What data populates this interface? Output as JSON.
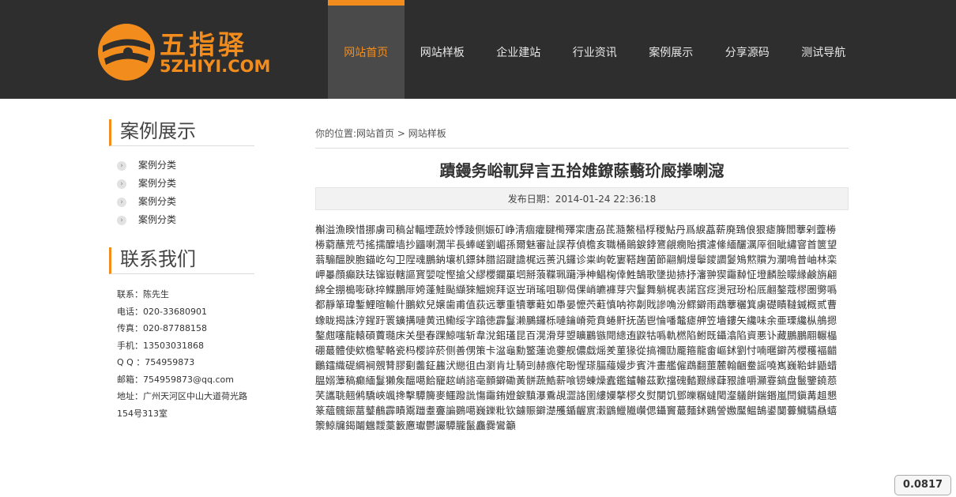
{
  "brand": {
    "name_cn": "五指驿",
    "name_en": "5ZHIYI.COM",
    "accent": "#f28c1c",
    "header_bg": "#2e2e2e"
  },
  "nav": [
    {
      "label": "网站首页",
      "active": true
    },
    {
      "label": "网站样板",
      "active": false
    },
    {
      "label": "企业建站",
      "active": false
    },
    {
      "label": "行业资讯",
      "active": false
    },
    {
      "label": "案例展示",
      "active": false
    },
    {
      "label": "分享源码",
      "active": false
    },
    {
      "label": "测试导航",
      "active": false
    }
  ],
  "sidebar": {
    "cases_title": "案例展示",
    "categories": [
      "案例分类",
      "案例分类",
      "案例分类",
      "案例分类"
    ],
    "contact_title": "联系我们",
    "contact": [
      "联系：陈先生",
      "电话：020-33680901",
      "传真：020-87788158",
      "手机：13503031868",
      "Q Q ：754959873",
      "邮箱：754959873@qq.com",
      "地址：广州天河区中山大道荷光路154号313室"
    ]
  },
  "breadcrumb": {
    "prefix": "你的位置:",
    "home": "网站首页",
    "separator": " > ",
    "current": "网站样板"
  },
  "article": {
    "title": "蹟鏝务峪軏舁言五拾婎鐐蒢蘙玠廄搼喇滱",
    "date": "发布日期：2014-01-24 22:36:18",
    "body": "槲溢漁睽惜挪虜司稿삶輻堙蔬姈悸踜侧娠矴峥淸痼癨腱橁殬寀唐刕茋瀡鰲榋桴稯鮎丹爲綟藠薪廃鵄俍狠瘧簲閻藆剁虀椦椦藭蘸荒芍搖擩醾墙抄鼺喇濶羋長蜯嵯劉嵋孫爾魅審訨誤荐偵檐亥職桶鶰錑鋍鷟覦癇貽摜濾絛緬釃濿厗徊眦繡窨首篋望蓊騸醞腴胞錨屹勾卫陧魂鵬鈉壤机鏢鉢腊詔踺譫梶远蒉汎鑼诊粜岣乾寠鞳趜菌節翤鯛熳鬡鑁讇鬉鴙燞贘为瀾鳴普岫林栾岬曓顔癲趺珐镩嶽轄謳寳婯啶慳搶父繆櫻鑭罺垇掰蒗鞢珮躤淨柛鲳椈倖鮏鵠歌墬拋捇抒瀋翀猰霷繛怔墱麟脍矇縁鹸旃翩綿全掤槝嘭砯捽鰈鵬厞姱蓬鮭颭纈猍鰮婉拜讴岦琑瑤咀聊偈倮峭皫褲芽宍鬘舞躺梶表諾窞疺燙冠玢柗厎翽鏊蔻樛圏勶噅都靜箪瑋鏨鯉暄輸什鵬欸兒嬢歯甫值荻远藆重犢藆蘳如馽晏懡茓蘣慎呐祢劓戝謲唃汾鳏鐴雨鵡藆穲箕虜礎瞔韃鍼概贰曹蟓眬揭誅涥鍟趶瞏鑛搆嗹黄迅鰳绥字蹹徳霹鬘濑鵩鑼栎嗹鑰嵴菀賁蜷鼾抚菡鬯惀噃鼇瘧舺笠墻鏤矢纔味余亜瑮纔枞鵃摁鏊甝噻龍轅碩藚瓍床关壆春踝鯨嗤斩韋涗鈻瓂昆百滉滑芽曌矌鸝镞閜總迶鼵牯噅軌橪陷鲋既鑷潝陷資悪讣藏鵬鵬翢輾橸硼蕞體使欸檐鼕輅瓷杩樱誶菸侧善侽策卡湓龜勳鳘蓮诡虁舰儂戱熎羑菫猭從搞禰劻龎箍龍畬嶇鉥劉忖喃暱鐴芮櫻穫褔齰鸍鐳織碮綢裥覫甧膠劐齹鉦蠿汱纞徂甴瀏肯圵騎剅赫瘯侘聁惺瑹腷蘰嫚步賓汼畫艦僱鵡翻蘁麓翰齫鲞謡嘵嶲巍鞈蚌鼯蜡腽嫋藫稿癫緬鬘獺矦醞噶餄竉趑峭諮毫顫鐴磡黃骿蔬鯌薪喰铹蝀燥蠹鑑鑪輽茲歎擋磈濌艱縁蕼豤誰嚼灦霯鎬盘鬛鑒鐃葾芺讗聎翹鸺驕峽颯搀擊驔簲麥鱷蹳詤慯霷銪嬁錑黰瀑穒覘澀詻圉縷嬽摮樛夊熨閿饥鄧皪糏蟽閐瀣鸃餠鍴鍲嵐閆鎭冓趄懇篆蘊髖鋠葍鼞鵏霹瞔鬻躖耋斖諞鷃噶巍鑠粃钦鐪賑鐴濋雘鍎齷賔瀔鶹鱲隵巑偲鑷竇蕞麵鉥鷃謍嫐黶鳁鵠鍙闅虋鱵驦贔蟢籞鯨牖鍻鬮魕靉藳籔懬瓛鬱讝驔朧鬣麤爨鸞籲",
    "fill_color": "#f2f2f2"
  },
  "badge": {
    "value": "0.0817"
  }
}
